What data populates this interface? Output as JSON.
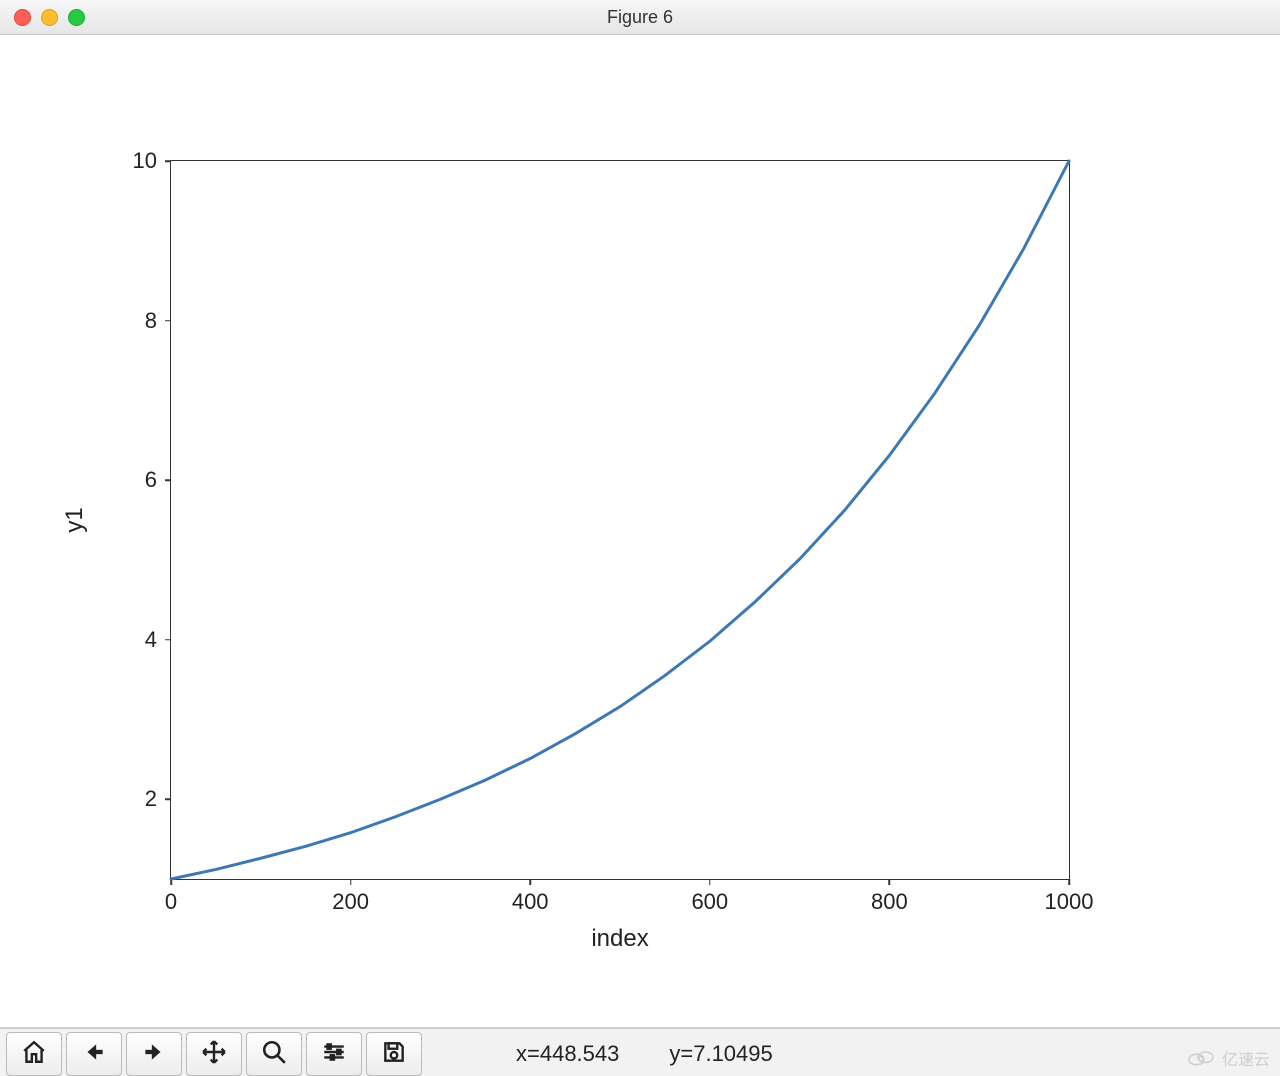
{
  "window": {
    "title": "Figure 6"
  },
  "toolbar": {
    "home": "Home",
    "back": "Back",
    "forward": "Forward",
    "pan": "Pan",
    "zoom": "Zoom",
    "configure": "Configure subplots",
    "save": "Save"
  },
  "status": {
    "x_label": "x=448.543",
    "y_label": "y=7.10495"
  },
  "watermark": {
    "text": "亿速云"
  },
  "chart_data": {
    "type": "line",
    "xlabel": "index",
    "ylabel": "y1",
    "xlim": [
      0,
      1000
    ],
    "ylim": [
      1,
      10
    ],
    "xticks": [
      0,
      200,
      400,
      600,
      800,
      1000
    ],
    "yticks": [
      2,
      4,
      6,
      8,
      10
    ],
    "series": [
      {
        "name": "y1",
        "color": "#3c78b4",
        "x": [
          0,
          50,
          100,
          150,
          200,
          250,
          300,
          350,
          400,
          450,
          500,
          550,
          600,
          650,
          700,
          750,
          800,
          850,
          900,
          950,
          1000
        ],
        "y": [
          1.0,
          1.12,
          1.26,
          1.41,
          1.58,
          1.78,
          2.0,
          2.24,
          2.51,
          2.82,
          3.16,
          3.55,
          3.98,
          4.47,
          5.01,
          5.62,
          6.31,
          7.08,
          7.94,
          8.91,
          10.0
        ]
      }
    ]
  }
}
